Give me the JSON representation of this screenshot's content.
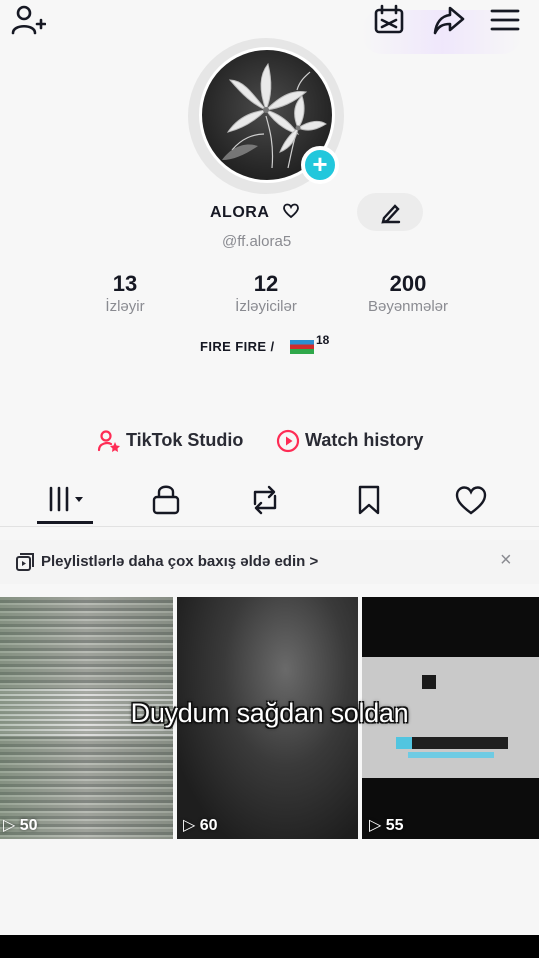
{
  "profile": {
    "display_name": "ALORA",
    "username": "@ff.alora5",
    "bio_text": "FIRE FIRE /",
    "bio_superscript": "18"
  },
  "stats": [
    {
      "value": "13",
      "label": "İzləyir"
    },
    {
      "value": "12",
      "label": "İzləyicilər"
    },
    {
      "value": "200",
      "label": "Bəyənmələr"
    }
  ],
  "links": {
    "studio": "TikTok Studio",
    "history": "Watch history"
  },
  "banner": {
    "text": "Pleylistlərlə daha çox baxış əldə edin >",
    "close": "×"
  },
  "videos": [
    {
      "views": "50"
    },
    {
      "views": "60"
    },
    {
      "views": "55"
    }
  ],
  "caption": "Duydum sağdan soldan",
  "colors": {
    "accent_teal": "#22c7dc",
    "accent_red": "#fe2c55"
  },
  "icons": {
    "top_bar": [
      "add-user-icon",
      "calendar-icon",
      "share-icon",
      "menu-icon"
    ],
    "tabs": [
      "videos-grid-icon",
      "lock-icon",
      "repost-icon",
      "bookmark-icon",
      "heart-icon"
    ]
  }
}
